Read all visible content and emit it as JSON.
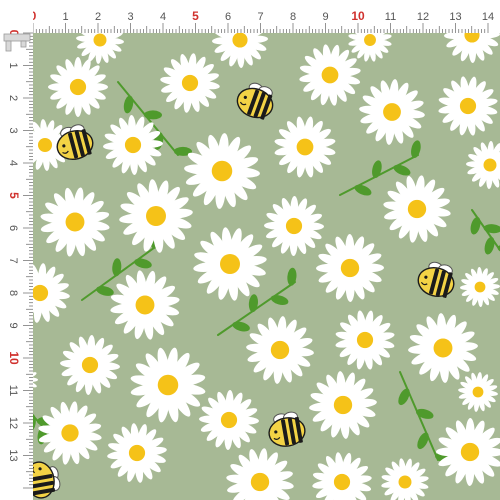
{
  "fabric": {
    "background_color": "#a7b995",
    "petal_color": "#ffffff",
    "center_color": "#f5c218",
    "leaf_color": "#4f9a2c",
    "bee_body_color": "#f3d345",
    "bee_stripe_color": "#1b1b1b",
    "motifs": [
      "daisy-flower",
      "bee",
      "leaf-sprig"
    ]
  },
  "ruler": {
    "unit": "cm",
    "top_labels": [
      "0",
      "1",
      "2",
      "3",
      "4",
      "5",
      "6",
      "7",
      "8",
      "9",
      "10",
      "11",
      "12",
      "13",
      "14"
    ],
    "left_labels": [
      "0",
      "1",
      "2",
      "3",
      "4",
      "5",
      "6",
      "7",
      "8",
      "9",
      "10",
      "11",
      "12",
      "13"
    ],
    "highlight_color": "#d0312d",
    "ruler_color": "#ffffff",
    "corner_icon": "calipers-icon"
  }
}
